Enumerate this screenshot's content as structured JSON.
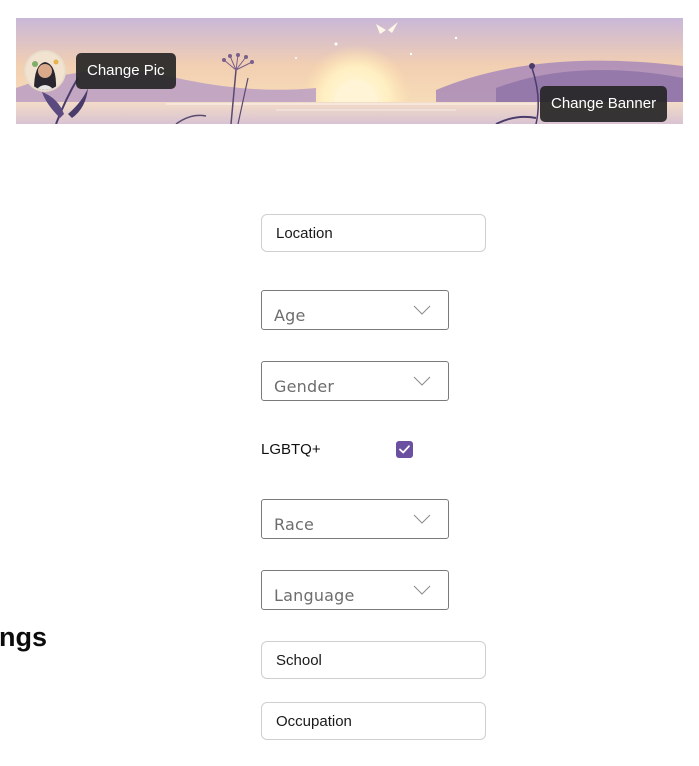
{
  "profile": {
    "change_pic_label": "Change Pic",
    "change_banner_label": "Change Banner"
  },
  "sidebar": {
    "heading": "ngs"
  },
  "form": {
    "location_placeholder": "Location",
    "age_label": "Age",
    "gender_label": "Gender",
    "lgbtq_label": "LGBTQ+",
    "lgbtq_checked": true,
    "race_label": "Race",
    "language_label": "Language",
    "school_placeholder": "School",
    "occupation_placeholder": "Occupation"
  },
  "colors": {
    "checkbox_accent": "#6b4fa0",
    "button_dark": "#262626"
  },
  "icons": {
    "select_chevron": "chevron-down-icon",
    "checkbox_mark": "checkmark-icon"
  }
}
